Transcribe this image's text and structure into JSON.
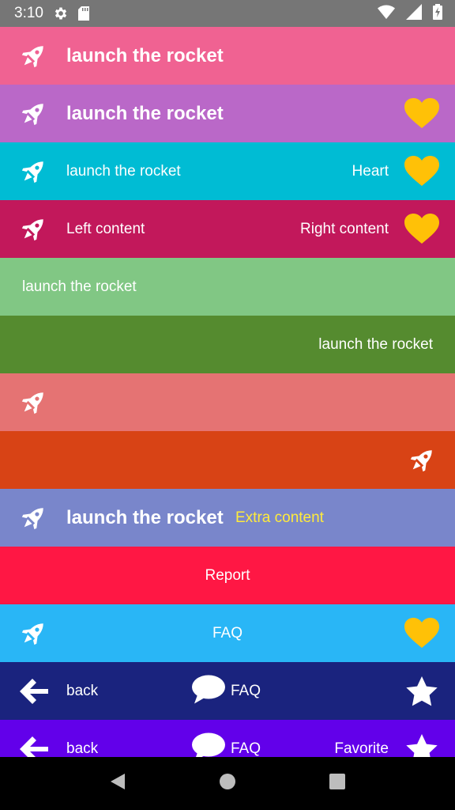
{
  "status_bar": {
    "time": "3:10",
    "icons": [
      "settings-icon",
      "sd-card-icon",
      "wifi-icon",
      "signal-icon",
      "battery-charging-icon"
    ]
  },
  "colors": {
    "heart": "#FFC107",
    "rows": [
      "#F06292",
      "#BA68C8",
      "#00BCD4",
      "#C2185B",
      "#81C784",
      "#558B2F",
      "#E57373",
      "#D84315",
      "#7986CB",
      "#FF1744",
      "#29B6F6",
      "#1A237E",
      "#6200EA"
    ],
    "extra_content": "#FFEB3B"
  },
  "rows": [
    {
      "title": "launch the rocket"
    },
    {
      "title": "launch the rocket"
    },
    {
      "title": "launch the rocket",
      "trailing_text": "Heart"
    },
    {
      "left_text": "Left content",
      "right_text": "Right content"
    },
    {
      "title": "launch the rocket"
    },
    {
      "title": "launch the rocket"
    },
    {},
    {},
    {
      "title": "launch the rocket",
      "extra": "Extra content"
    },
    {
      "center_text": "Report"
    },
    {
      "center_text": "FAQ"
    },
    {
      "left_text": "back",
      "center_text": "FAQ"
    },
    {
      "left_text": "back",
      "center_text": "FAQ",
      "right_text": "Favorite"
    }
  ],
  "nav": {
    "back": "back-nav-icon",
    "home": "home-nav-icon",
    "recents": "recents-nav-icon"
  }
}
